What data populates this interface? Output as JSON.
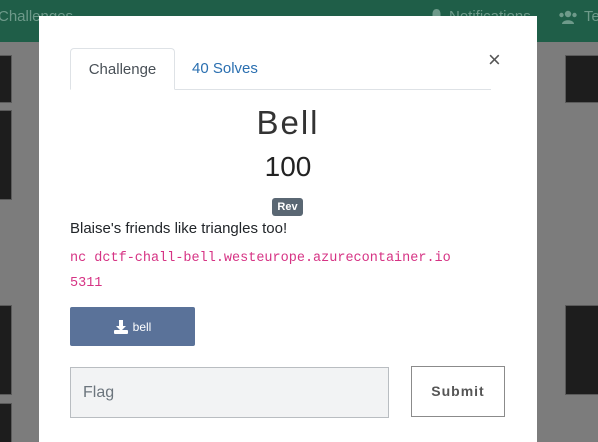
{
  "navbar": {
    "left_label": "Challenges",
    "notifications_label": "Notifications",
    "team_label": "Team"
  },
  "modal": {
    "tabs": [
      {
        "label": "Challenge"
      },
      {
        "label": "40 Solves"
      }
    ],
    "close_symbol": "×",
    "title": "Bell",
    "points": "100",
    "category_badge": "Rev",
    "description": "Blaise's friends like triangles too!",
    "connection_line1": "nc dctf-chall-bell.westeurope.azurecontainer.io",
    "connection_line2": "5311",
    "download_label": "bell",
    "flag_placeholder": "Flag",
    "submit_label": "Submit"
  },
  "icons": {
    "bell": "bell-icon",
    "users": "users-icon",
    "download": "download-icon"
  },
  "colors": {
    "navbar": "#1f5e48",
    "link": "#2a6fb0",
    "code": "#d63384",
    "download_button": "#5a7299",
    "badge": "#5a6773"
  }
}
